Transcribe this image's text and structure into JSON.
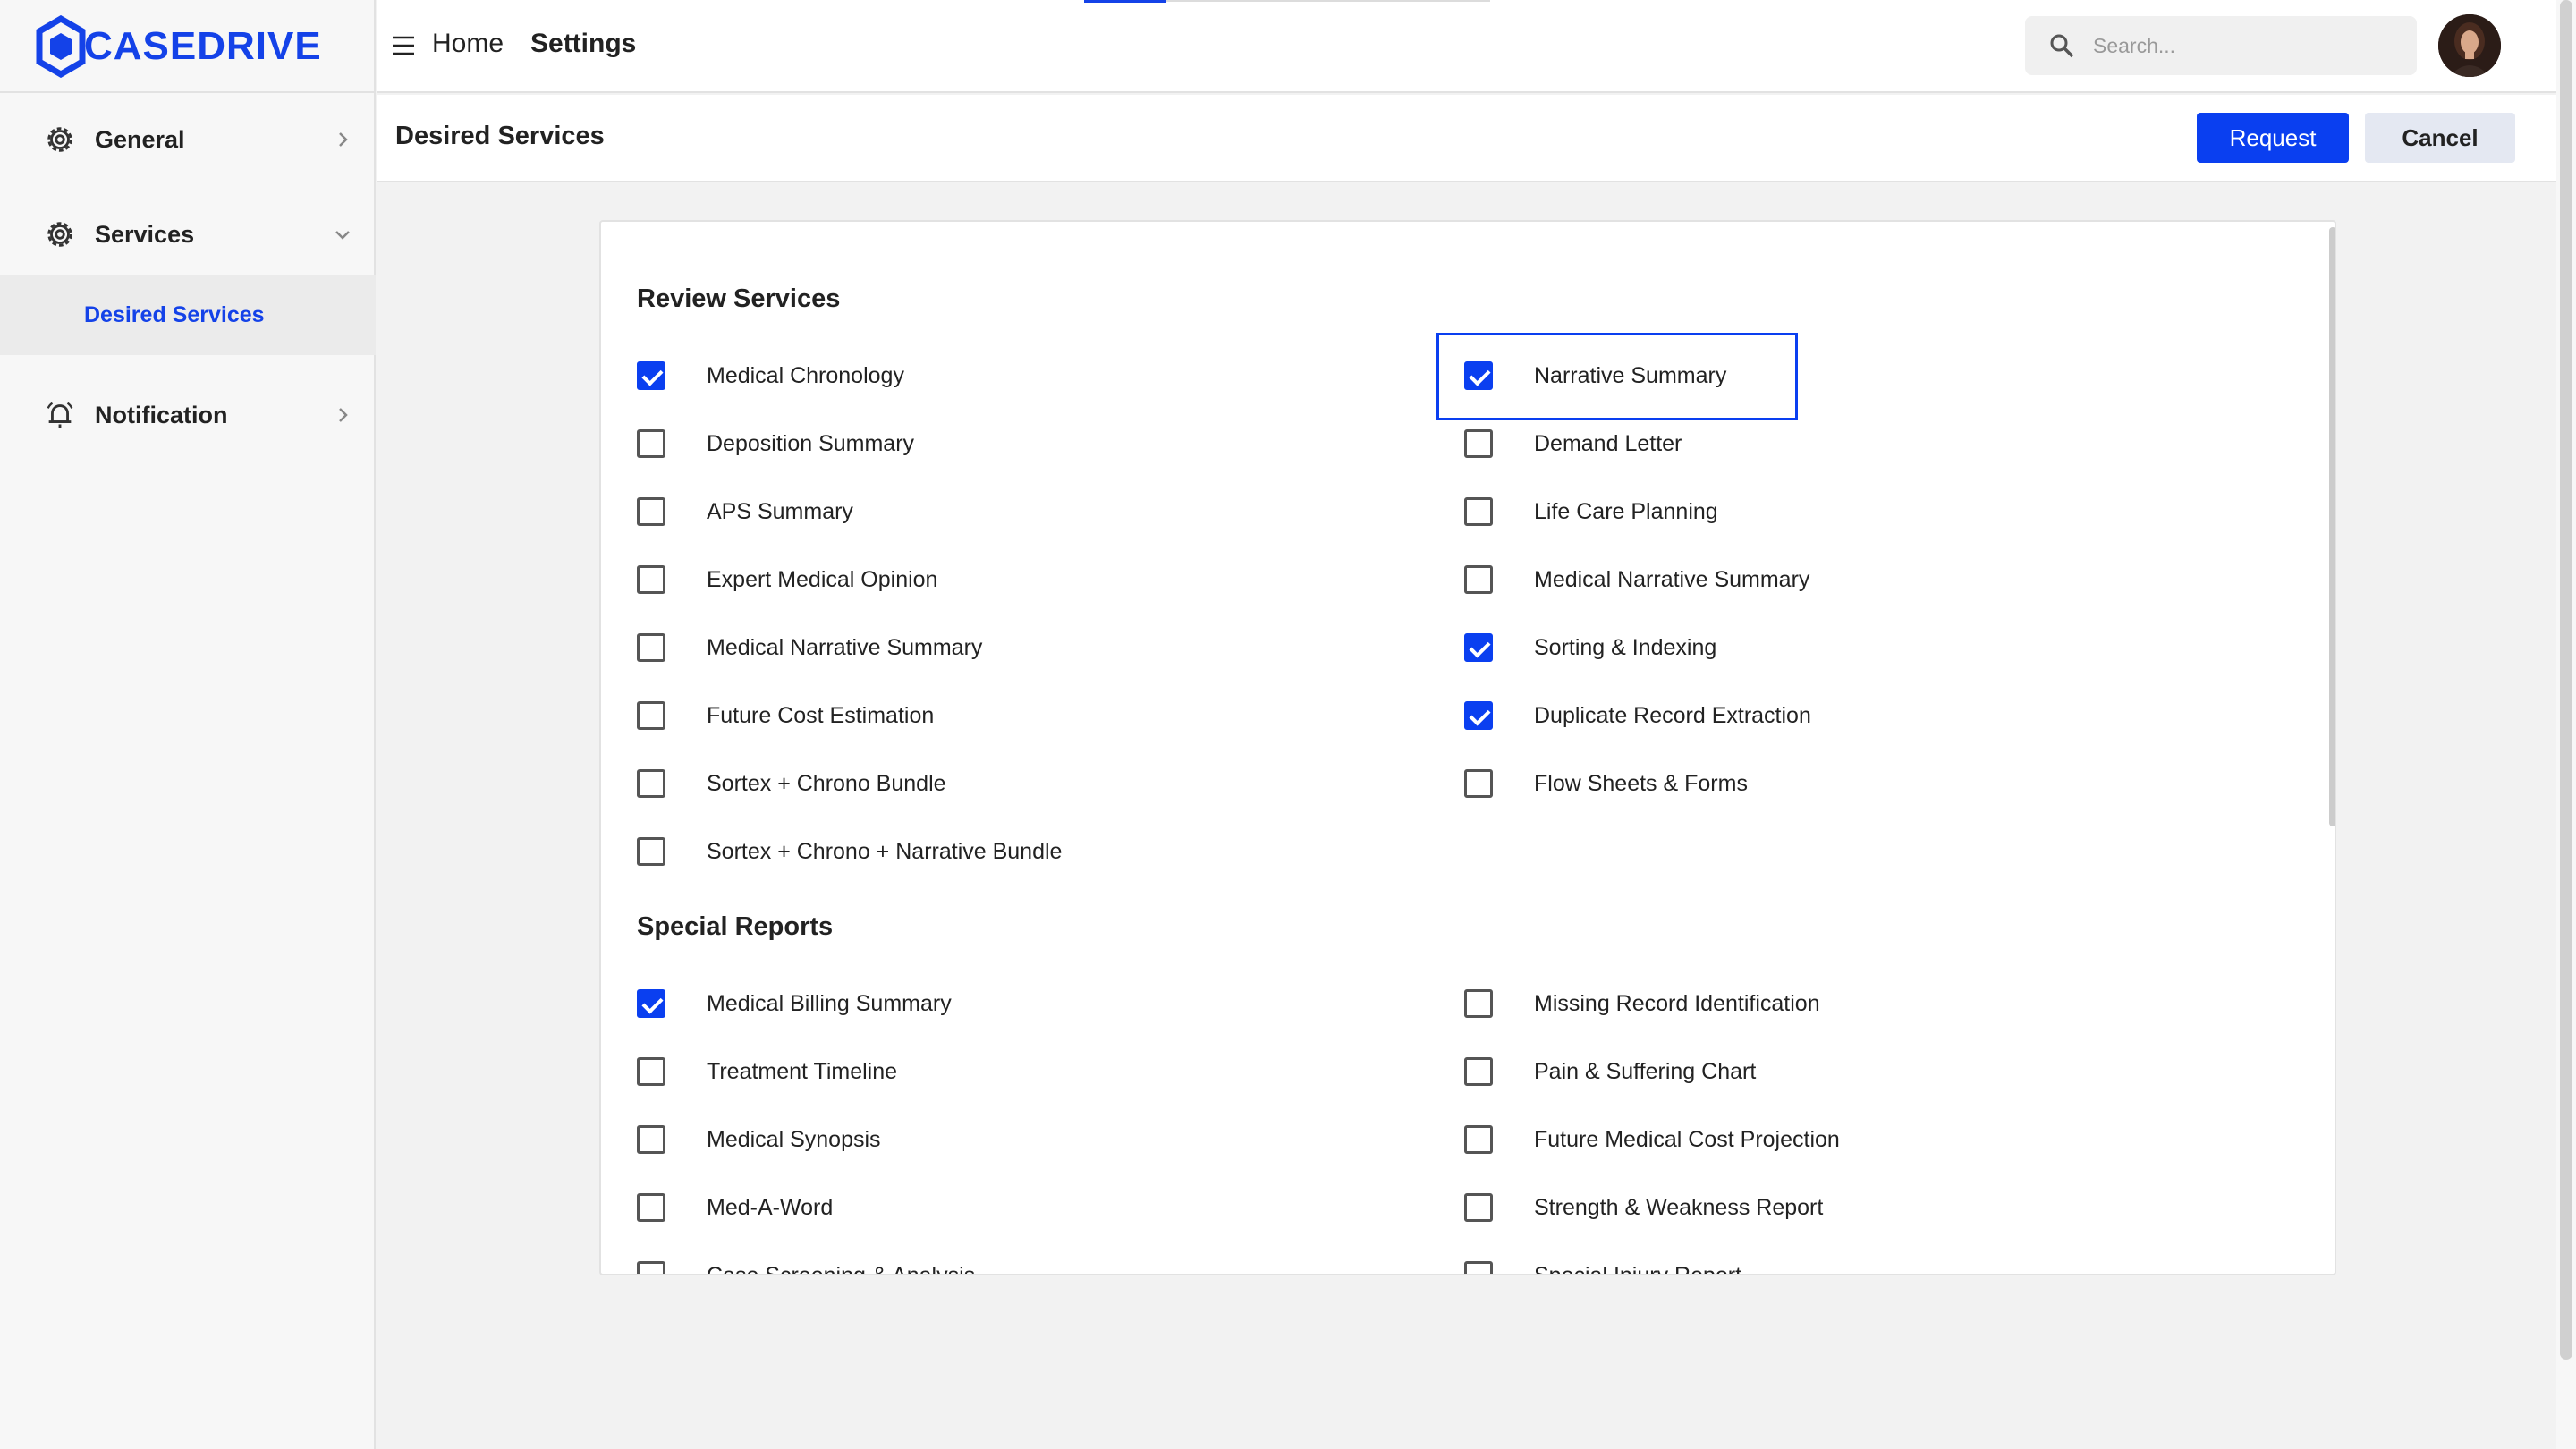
{
  "brand": {
    "name": "CASEDRIVE",
    "color": "#1442e8"
  },
  "sidebar": {
    "items": [
      {
        "label": "General",
        "icon": "gear-icon",
        "expanded": false
      },
      {
        "label": "Services",
        "icon": "services-gear-icon",
        "expanded": true,
        "children": [
          {
            "label": "Desired Services",
            "active": true
          }
        ]
      },
      {
        "label": "Notification",
        "icon": "bell-icon",
        "expanded": false
      }
    ]
  },
  "topbar": {
    "breadcrumb": {
      "home": "Home",
      "current": "Settings"
    },
    "search": {
      "placeholder": "Search..."
    }
  },
  "header": {
    "title": "Desired Services",
    "request_label": "Request",
    "cancel_label": "Cancel"
  },
  "sections": [
    {
      "title": "Review Services",
      "left": [
        {
          "label": "Medical Chronology",
          "checked": true
        },
        {
          "label": "Deposition Summary",
          "checked": false
        },
        {
          "label": "APS Summary",
          "checked": false
        },
        {
          "label": "Expert Medical Opinion",
          "checked": false
        },
        {
          "label": "Medical Narrative Summary",
          "checked": false
        },
        {
          "label": "Future Cost Estimation",
          "checked": false
        },
        {
          "label": "Sortex + Chrono Bundle",
          "checked": false
        },
        {
          "label": "Sortex + Chrono + Narrative Bundle",
          "checked": false
        }
      ],
      "right": [
        {
          "label": "Narrative Summary",
          "checked": true,
          "focused": true
        },
        {
          "label": "Demand Letter",
          "checked": false
        },
        {
          "label": "Life Care Planning",
          "checked": false
        },
        {
          "label": "Medical Narrative Summary",
          "checked": false
        },
        {
          "label": "Sorting & Indexing",
          "checked": true
        },
        {
          "label": "Duplicate Record Extraction",
          "checked": true
        },
        {
          "label": "Flow Sheets & Forms",
          "checked": false
        }
      ]
    },
    {
      "title": "Special Reports",
      "left": [
        {
          "label": "Medical Billing Summary",
          "checked": true
        },
        {
          "label": "Treatment Timeline",
          "checked": false
        },
        {
          "label": "Medical Synopsis",
          "checked": false
        },
        {
          "label": "Med-A-Word",
          "checked": false
        },
        {
          "label": "Case Screening & Analysis",
          "checked": false
        }
      ],
      "right": [
        {
          "label": "Missing Record Identification",
          "checked": false
        },
        {
          "label": "Pain & Suffering Chart",
          "checked": false
        },
        {
          "label": "Future Medical Cost Projection",
          "checked": false
        },
        {
          "label": "Strength & Weakness Report",
          "checked": false
        },
        {
          "label": "Special Injury Report",
          "checked": false
        }
      ]
    }
  ]
}
